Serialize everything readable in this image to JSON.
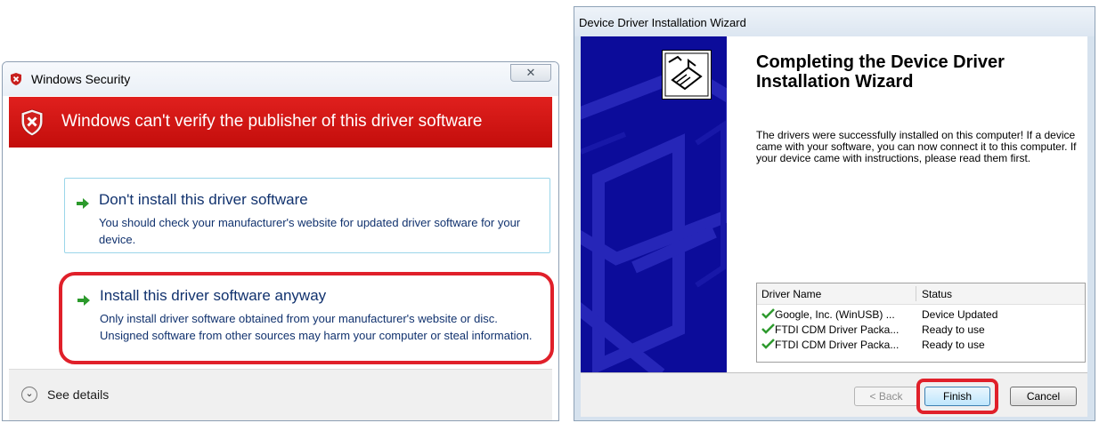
{
  "security_dialog": {
    "title": "Windows Security",
    "close_glyph": "✕",
    "banner_text": "Windows can't verify the publisher of this driver software",
    "options": [
      {
        "title": "Don't install this driver software",
        "description": "You should check your manufacturer's website for updated driver software for your device."
      },
      {
        "title": "Install this driver software anyway",
        "description": "Only install driver software obtained from your manufacturer's website or disc. Unsigned software from other sources may harm your computer or steal information."
      }
    ],
    "details_label": "See details",
    "details_glyph": "⌄"
  },
  "wizard": {
    "title": "Device Driver Installation Wizard",
    "heading": "Completing the Device Driver Installation Wizard",
    "body": "The drivers were successfully installed on this computer! If a device came with your software, you can now connect it to this computer. If your device came with instructions, please read them first.",
    "table": {
      "headers": [
        "Driver Name",
        "Status"
      ],
      "rows": [
        {
          "name": "Google, Inc. (WinUSB) ...",
          "status": "Device Updated"
        },
        {
          "name": "FTDI CDM Driver Packa...",
          "status": "Ready to use"
        },
        {
          "name": "FTDI CDM Driver Packa...",
          "status": "Ready to use"
        }
      ]
    },
    "buttons": {
      "back": "< Back",
      "finish": "Finish",
      "cancel": "Cancel"
    }
  },
  "colors": {
    "banner_red": "#d3110f",
    "highlight_red": "#e0202a",
    "link_blue": "#11326e",
    "wizard_side_blue": "#0c0c9a",
    "check_green": "#2e9a2e"
  },
  "icons": {
    "title_shield": "shield-x-icon",
    "banner_shield": "shield-x-icon",
    "option_arrow": "green-arrow-icon",
    "details": "chevron-down-icon",
    "wizard_logo": "hardware-install-icon",
    "row_status": "check-icon"
  }
}
